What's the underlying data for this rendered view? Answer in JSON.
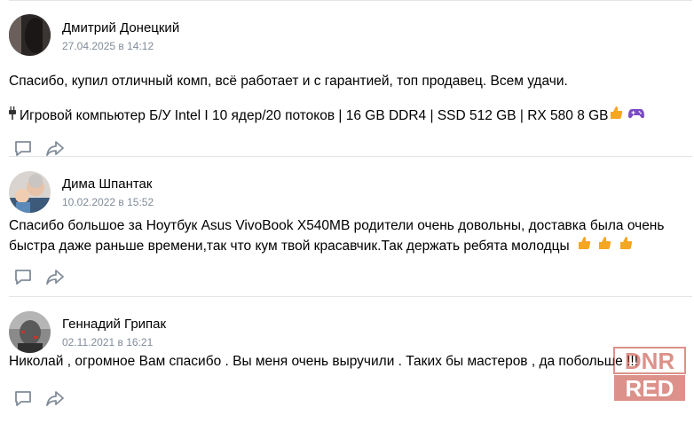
{
  "reviews": [
    {
      "author": "Дмитрий Донецкий",
      "date": "27.04.2025 в 14:12",
      "text": "Спасибо, купил отличный комп, всё работает и с гарантией, топ продавец. Всем удачи.",
      "product": "Игровой компьютер Б/У Intel I 10 ядер/20 потоков | 16 GB DDR4 | SSD 512 GB | RX 580 8 GB",
      "product_icon": "plug-icon",
      "trailing_icons": [
        "thumbs-up-icon",
        "gamepad-icon"
      ]
    },
    {
      "author": "Дима Шпантак",
      "date": "10.02.2022 в 15:52",
      "text": "Спасибо большое за Ноутбук Asus VivoBook X540MB родители очень довольны, доставка была очень быстра даже раньше времени,так что кум твой красавчик.Так держать ребята молодцы",
      "trailing_icons": [
        "thumbs-up-icon",
        "thumbs-up-icon",
        "thumbs-up-icon"
      ]
    },
    {
      "author": "Геннадий Грипак",
      "date": "02.11.2021 в 16:21",
      "text": "Николай , огромное Вам спасибо . Вы меня очень выручили . Таких бы мастеров , да побольше !!!"
    }
  ],
  "actions": [
    "comment-icon",
    "share-icon"
  ],
  "watermark": {
    "line1": "DNR",
    "line2": "RED"
  },
  "colors": {
    "date": "#818c99",
    "divider": "#e2e4e8",
    "icon": "#818c99",
    "thumb": "#f5a623",
    "gamepad": "#7b4bc6"
  }
}
